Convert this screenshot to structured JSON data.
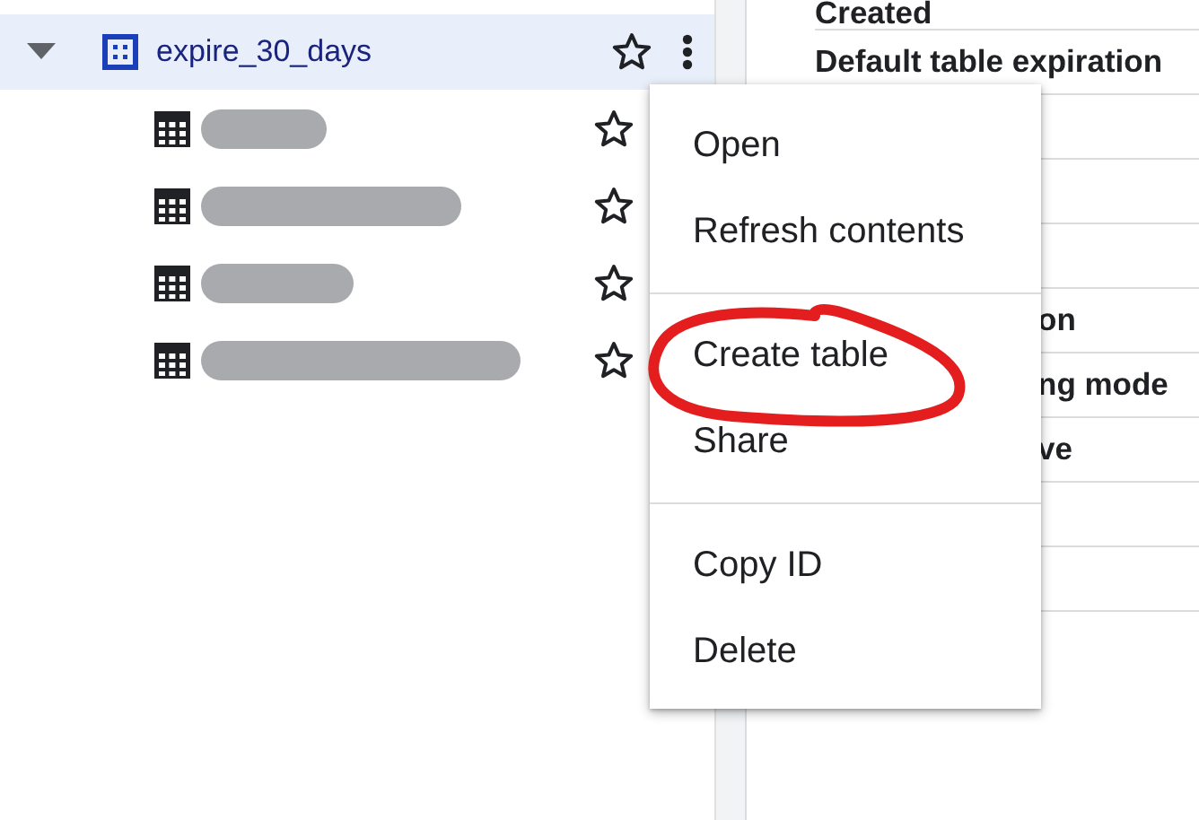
{
  "tree": {
    "dataset": {
      "name": "expire_30_days",
      "expanded": true,
      "selected": true
    },
    "children": [
      {
        "kind": "table",
        "redacted": true
      },
      {
        "kind": "table",
        "redacted": true
      },
      {
        "kind": "table",
        "redacted": true
      },
      {
        "kind": "table",
        "redacted": true
      }
    ]
  },
  "details": {
    "rows": [
      {
        "kind": "text",
        "label": "Created"
      },
      {
        "kind": "text",
        "label": "Default table expiration"
      },
      {
        "kind": "blank"
      },
      {
        "kind": "blank"
      },
      {
        "kind": "blank"
      },
      {
        "kind": "covered",
        "label": "on"
      },
      {
        "kind": "covered",
        "label": "ng mode"
      },
      {
        "kind": "covered",
        "label": "ve"
      },
      {
        "kind": "blank"
      },
      {
        "kind": "blank"
      }
    ]
  },
  "context_menu": {
    "groups": [
      [
        {
          "label": "Open",
          "circled": false
        },
        {
          "label": "Refresh contents",
          "circled": false
        }
      ],
      [
        {
          "label": "Create table",
          "circled": true
        },
        {
          "label": "Share",
          "circled": false
        }
      ],
      [
        {
          "label": "Copy ID",
          "circled": false
        },
        {
          "label": "Delete",
          "circled": false
        }
      ]
    ]
  }
}
